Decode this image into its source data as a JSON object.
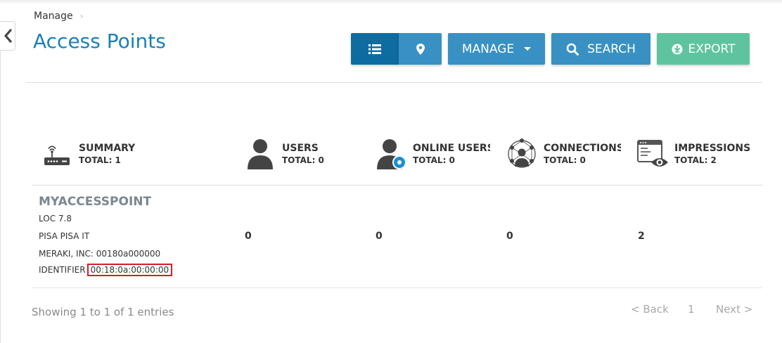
{
  "breadcrumb": {
    "parent": "Manage"
  },
  "page": {
    "title": "Access Points"
  },
  "toolbar": {
    "list_icon": "list-icon",
    "map_icon": "map-pin-icon",
    "manage_label": "MANAGE",
    "search_label": "SEARCH",
    "export_label": "EXPORT"
  },
  "stats": [
    {
      "icon": "router-icon",
      "label": "SUMMARY",
      "total": "TOTAL: 1"
    },
    {
      "icon": "user-icon",
      "label": "USERS",
      "total": "TOTAL: 0"
    },
    {
      "icon": "online-user-icon",
      "label": "ONLINE USERS",
      "total": "TOTAL: 0"
    },
    {
      "icon": "connections-icon",
      "label": "CONNECTIONS",
      "total": "TOTAL: 0"
    },
    {
      "icon": "impressions-icon",
      "label": "IMPRESSIONS",
      "total": "TOTAL: 2"
    }
  ],
  "row": {
    "name": "MYACCESSPOINT",
    "loc": "LOC 7.8",
    "place": "PISA PISA IT",
    "vendor": "MERAKI, INC: 00180a000000",
    "identifier_label": "IDENTIFIER",
    "identifier_value": "00:18:0a:00:00:00",
    "users": "0",
    "online_users": "0",
    "connections": "0",
    "impressions": "2"
  },
  "footer": {
    "entries": "Showing 1 to 1 of 1 entries",
    "back": "< Back",
    "page": "1",
    "next": "Next >"
  },
  "colors": {
    "title": "#1a80b6",
    "primary_dark": "#0f6ca0",
    "primary": "#3891c2",
    "export": "#5ec4a0",
    "highlight": "#d21f2a"
  }
}
